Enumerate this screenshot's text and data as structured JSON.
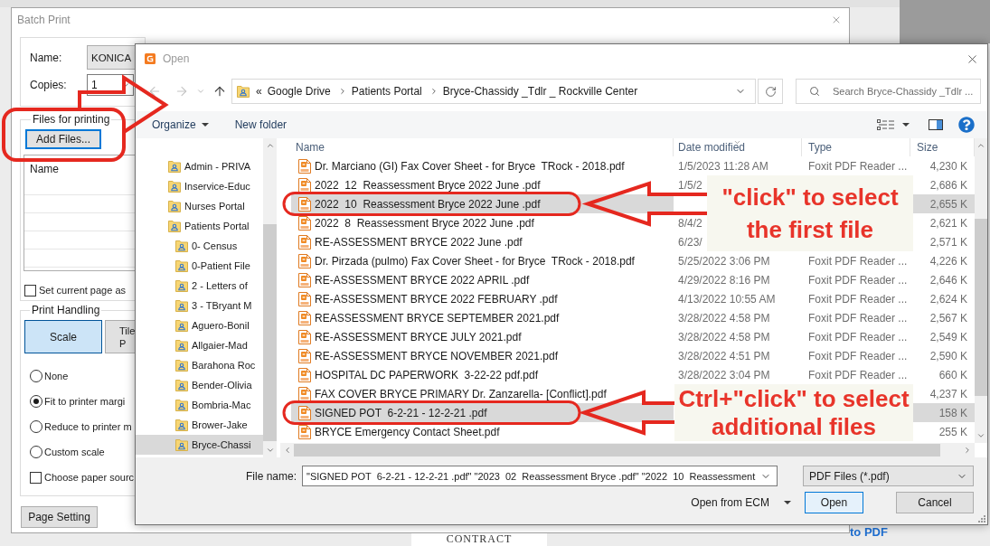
{
  "background": {
    "document_heading": "CONTRACT",
    "link": "to PDF"
  },
  "batch_print": {
    "title": "Batch Print",
    "printer": {
      "name_label": "Name:",
      "name_value": "KONICA",
      "copies_label": "Copies:",
      "copies_value": "1"
    },
    "files": {
      "group_label": "Files for printing",
      "add_button": "Add Files...",
      "list_header": "Name",
      "set_current_page": {
        "label": "Set current page as",
        "checked": false
      }
    },
    "print_handling": {
      "group_label": "Print Handling",
      "modes": [
        {
          "label": "Scale",
          "selected": true
        },
        {
          "label": "Tile\nP",
          "selected": false
        }
      ],
      "scaling": [
        {
          "label": "None",
          "selected": false
        },
        {
          "label": "Fit to printer margi",
          "selected": true
        },
        {
          "label": "Reduce to printer m",
          "selected": false
        },
        {
          "label": "Custom scale",
          "selected": false
        }
      ],
      "paper_source": {
        "label": "Choose paper sourc",
        "checked": false
      }
    },
    "page_setting_button": "Page Setting"
  },
  "open_dialog": {
    "title": "Open",
    "navigation": {
      "back": {
        "disabled": true
      },
      "forward": {
        "disabled": true
      },
      "up": {
        "disabled": false
      }
    },
    "address": {
      "overflow": "«",
      "crumbs": [
        "Google Drive",
        "Patients Portal",
        "Bryce-Chassidy _Tdlr _ Rockville Center"
      ]
    },
    "search": {
      "placeholder": "Search Bryce-Chassidy _Tdlr ..."
    },
    "toolbar": {
      "organize": "Organize",
      "new_folder": "New folder"
    },
    "nav_tree": [
      {
        "label": "Admin - PRIVA",
        "selected": false
      },
      {
        "label": "Inservice-Educ",
        "selected": false
      },
      {
        "label": "Nurses Portal",
        "selected": false
      },
      {
        "label": "Patients Portal",
        "selected": false,
        "children": [
          {
            "label": "0- Census",
            "selected": false
          },
          {
            "label": "0-Patient File",
            "selected": false
          },
          {
            "label": "2 - Letters of",
            "selected": false
          },
          {
            "label": "3 - TBryant M",
            "selected": false
          },
          {
            "label": "Aguero-Bonil",
            "selected": false
          },
          {
            "label": "Allgaier-Mad",
            "selected": false
          },
          {
            "label": "Barahona Roc",
            "selected": false
          },
          {
            "label": "Bender-Olivia",
            "selected": false
          },
          {
            "label": "Bombria-Mac",
            "selected": false
          },
          {
            "label": "Brower-Jake",
            "selected": false
          },
          {
            "label": "Bryce-Chassi",
            "selected": true
          }
        ]
      }
    ],
    "columns": [
      "Name",
      "Date modified",
      "Type",
      "Size"
    ],
    "files": [
      {
        "name": "Dr. Marciano (GI) Fax Cover Sheet - for Bryce  TRock - 2018.pdf",
        "date": "1/5/2023 11:28 AM",
        "type": "Foxit PDF Reader ...",
        "size": "4,230 K",
        "selected": false
      },
      {
        "name": "2022  12  Reassessment Bryce 2022 June .pdf",
        "date": "1/5/2",
        "size": "2,686 K",
        "selected": false
      },
      {
        "name": "2022  10  Reassessment Bryce 2022 June .pdf",
        "size": "2,655 K",
        "selected": true
      },
      {
        "name": "2022  8  Reassessment Bryce 2022 June .pdf",
        "date": "8/4/2",
        "size": "2,621 K",
        "selected": false
      },
      {
        "name": "RE-ASSESSMENT BRYCE 2022 June .pdf",
        "date": "6/23/",
        "size": "2,571 K",
        "selected": false
      },
      {
        "name": "Dr. Pirzada (pulmo) Fax Cover Sheet - for Bryce  TRock - 2018.pdf",
        "date": "5/25/2022 3:06 PM",
        "type": "Foxit PDF Reader ...",
        "size": "4,226 K",
        "selected": false
      },
      {
        "name": "RE-ASSESSMENT BRYCE 2022 APRIL .pdf",
        "date": "4/29/2022 8:16 PM",
        "type": "Foxit PDF Reader ...",
        "size": "2,646 K",
        "selected": false
      },
      {
        "name": "RE-ASSESSMENT BRYCE 2022 FEBRUARY .pdf",
        "date": "4/13/2022 10:55 AM",
        "type": "Foxit PDF Reader ...",
        "size": "2,624 K",
        "selected": false
      },
      {
        "name": "REASSESSMENT BRYCE SEPTEMBER 2021.pdf",
        "date": "3/28/2022 4:58 PM",
        "type": "Foxit PDF Reader ...",
        "size": "2,567 K",
        "selected": false
      },
      {
        "name": "RE-ASSESSMENT BRYCE JULY 2021.pdf",
        "date": "3/28/2022 4:58 PM",
        "type": "Foxit PDF Reader ...",
        "size": "2,549 K",
        "selected": false
      },
      {
        "name": "RE-ASSESSMENT BRYCE NOVEMBER 2021.pdf",
        "date": "3/28/2022 4:51 PM",
        "type": "Foxit PDF Reader ...",
        "size": "2,590 K",
        "selected": false
      },
      {
        "name": "HOSPITAL DC PAPERWORK  3-22-22 pdf.pdf",
        "date": "3/28/2022 3:04 PM",
        "type": "Foxit PDF Reader ...",
        "size": "660 K",
        "selected": false
      },
      {
        "name": "FAX COVER BRYCE PRIMARY Dr. Zanzarella- [Conflict].pdf",
        "size": "4,237 K",
        "selected": false
      },
      {
        "name": "SIGNED POT  6-2-21 - 12-2-21 .pdf",
        "size": "158 K",
        "selected": true
      },
      {
        "name": "BRYCE Emergency Contact Sheet.pdf",
        "size": "255 K",
        "selected": false
      }
    ],
    "file_name": {
      "label": "File name:",
      "value": "\"SIGNED POT  6-2-21 - 12-2-21 .pdf\" \"2023  02  Reassessment Bryce .pdf\" \"2022  10  Reassessment"
    },
    "file_type": "PDF Files (*.pdf)",
    "open_from": "Open from ECM",
    "buttons": [
      {
        "label": "Open",
        "kind": "primary"
      },
      {
        "label": "Cancel",
        "kind": "secondary"
      }
    ]
  },
  "annotations": [
    {
      "kind": "callout",
      "text": "\"click\" to select\nthe first file"
    },
    {
      "kind": "callout",
      "text": "Ctrl+\"click\" to select\nadditional files"
    }
  ]
}
